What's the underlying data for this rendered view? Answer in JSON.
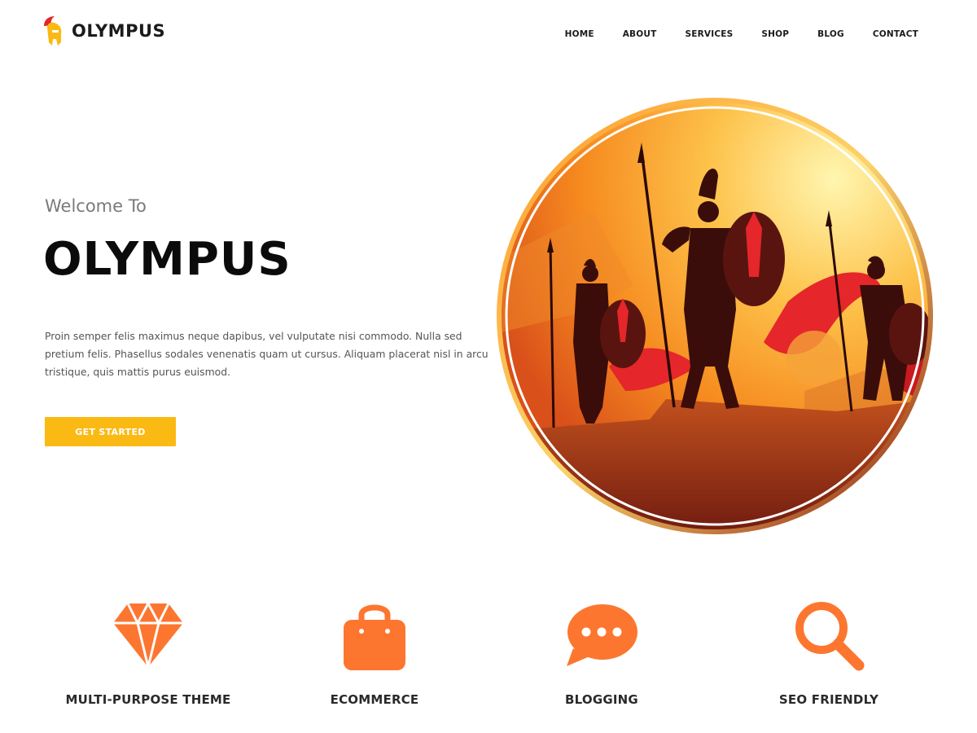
{
  "brand": {
    "name": "OLYMPUS"
  },
  "nav": {
    "items": [
      "HOME",
      "ABOUT",
      "SERVICES",
      "SHOP",
      "BLOG",
      "CONTACT"
    ]
  },
  "hero": {
    "subtitle": "Welcome To",
    "title": "OLYMPUS",
    "text": "Proin semper felis maximus neque dapibus, vel vulputate nisi commodo. Nulla sed pretium felis. Phasellus sodales venenatis quam ut cursus. Aliquam placerat nisl in arcu tristique, quis mattis purus euismod.",
    "cta_label": "GET STARTED",
    "image_icon": "spartan-warriors-illustration"
  },
  "features": [
    {
      "icon": "diamond-icon",
      "label": "MULTI-PURPOSE THEME"
    },
    {
      "icon": "shopping-bag-icon",
      "label": "ECOMMERCE"
    },
    {
      "icon": "chat-bubble-icon",
      "label": "BLOGGING"
    },
    {
      "icon": "search-icon",
      "label": "SEO FRIENDLY"
    }
  ],
  "colors": {
    "accent": "#fbb913",
    "icon_orange": "#fd7630",
    "helmet_red": "#e5262a",
    "text_dark": "#0b0b0b"
  }
}
